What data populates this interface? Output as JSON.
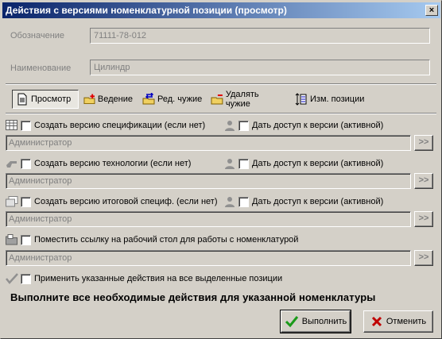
{
  "window": {
    "title": "Действия с версиями номенклатурной позиции (просмотр)",
    "close_glyph": "×"
  },
  "fields": {
    "designation_label": "Обозначение",
    "designation_value": "71111-78-012",
    "name_label": "Наименование",
    "name_value": "Цилиндр"
  },
  "toolbar": {
    "view": "Просмотр",
    "lead": "Ведение",
    "edit_others": "Ред. чужие",
    "delete_others": "Удалять чужие",
    "change_positions": "Изм. позиции"
  },
  "sections": [
    {
      "create_label": "Создать версию спецификации (если нет)",
      "access_label": "Дать доступ к версии (активной)",
      "user": "Администратор",
      "icon": "table-icon"
    },
    {
      "create_label": "Создать версию технологии (если нет)",
      "access_label": "Дать доступ к версии (активной)",
      "user": "Администратор",
      "icon": "hand-icon"
    },
    {
      "create_label": "Создать версию итоговой специф. (если нет)",
      "access_label": "Дать доступ к версии (активной)",
      "user": "Администратор",
      "icon": "cards-icon"
    },
    {
      "create_label": "Поместить ссылку на рабочий стол для работы с номенклатурой",
      "user": "Администратор",
      "icon": "folder-icon"
    }
  ],
  "more_label": ">>",
  "apply_all_label": "Применить указанные действия на все выделенные позиции",
  "instruction": "Выполните все необходимые действия для  указанной номенклатуры",
  "buttons": {
    "ok": "Выполнить",
    "cancel": "Отменить"
  },
  "colors": {
    "title_start": "#0a246a",
    "title_end": "#a6caf0",
    "face": "#d4d0c8",
    "ok_check": "#1a9a1a",
    "cancel_x": "#c00000"
  }
}
